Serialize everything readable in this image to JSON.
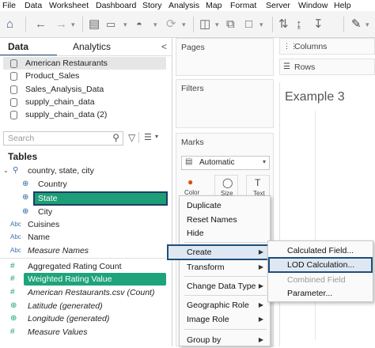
{
  "menubar": [
    "File",
    "Data",
    "Worksheet",
    "Dashboard",
    "Story",
    "Analysis",
    "Map",
    "Format",
    "Server",
    "Window",
    "Help"
  ],
  "left_tabs": {
    "data": "Data",
    "analytics": "Analytics",
    "collapse": "<"
  },
  "datasources": [
    "American Restaurants",
    "Product_Sales",
    "Sales_Analysis_Data",
    "supply_chain_data",
    "supply_chain_data (2)"
  ],
  "search": {
    "placeholder": "Search"
  },
  "tables_label": "Tables",
  "hierarchy": "country, state, city",
  "fields": [
    {
      "icon": "globe-icon",
      "glyph": "⊕",
      "label": "Country"
    },
    {
      "icon": "globe-icon",
      "glyph": "⊕",
      "label": "State"
    },
    {
      "icon": "globe-icon",
      "glyph": "⊕",
      "label": "City"
    },
    {
      "icon": "abc-icon",
      "glyph": "Abc",
      "label": "Cuisines"
    },
    {
      "icon": "abc-icon",
      "glyph": "Abc",
      "label": "Name"
    },
    {
      "icon": "abc-icon",
      "glyph": "Abc",
      "label": "Measure Names"
    },
    {
      "icon": "hash-icon",
      "glyph": "#",
      "label": "Aggregated Rating Count"
    },
    {
      "icon": "hash-icon",
      "glyph": "#",
      "label": "Weighted Rating Value"
    },
    {
      "icon": "hash-icon",
      "glyph": "#",
      "label": "American Restaurants.csv (Count)"
    },
    {
      "icon": "globe-icon",
      "glyph": "⊕",
      "label": "Latitude (generated)"
    },
    {
      "icon": "globe-icon",
      "glyph": "⊕",
      "label": "Longitude (generated)"
    },
    {
      "icon": "hash-icon",
      "glyph": "#",
      "label": "Measure Values"
    }
  ],
  "shelves": {
    "pages": "Pages",
    "filters": "Filters",
    "marks": "Marks",
    "marks_type": "Automatic",
    "marks_buttons": [
      "Color",
      "Size",
      "Text"
    ],
    "columns": "Columns",
    "rows": "Rows"
  },
  "sheet_title": "Example 3",
  "context_menu": [
    {
      "label": "Duplicate",
      "sub": false
    },
    {
      "label": "Reset Names",
      "sub": false
    },
    {
      "label": "Hide",
      "sub": false
    },
    {
      "label": "Create",
      "sub": true
    },
    {
      "label": "Transform",
      "sub": true
    },
    {
      "label": "Change Data Type",
      "sub": true
    },
    {
      "label": "Geographic Role",
      "sub": true
    },
    {
      "label": "Image Role",
      "sub": true
    },
    {
      "label": "Group by",
      "sub": true
    }
  ],
  "create_submenu": [
    {
      "label": "Calculated Field...",
      "disabled": false
    },
    {
      "label": "LOD Calculation...",
      "disabled": false
    },
    {
      "label": "Combined Field",
      "disabled": true
    },
    {
      "label": "Parameter...",
      "disabled": false
    }
  ],
  "colors": {
    "accent_green": "#1ea37a",
    "highlight_blue": "#1e4e7a",
    "toolbar_bg": "#f4f4f4"
  }
}
